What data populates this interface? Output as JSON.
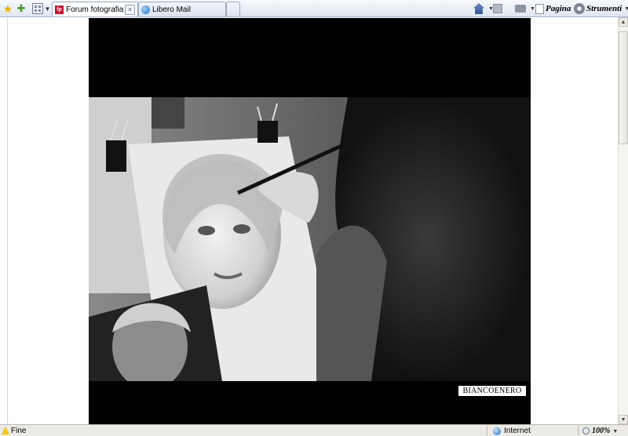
{
  "toolbar": {
    "tabs": [
      {
        "label": "Forum fotografia : photo...",
        "close": "×"
      },
      {
        "label": "Libero Mail"
      }
    ],
    "commands": {
      "page_label": "Pagina",
      "tools_label": "Strumenti"
    },
    "icons": [
      "favorites-star-icon",
      "add-favorite-icon",
      "quick-tabs-icon",
      "home-icon",
      "feeds-icon",
      "print-icon",
      "page-icon",
      "tools-gear-icon"
    ]
  },
  "content": {
    "watermark": "BIANCOENERO"
  },
  "statusbar": {
    "status_text": "Fine",
    "zone": "Internet",
    "zoom": "100%"
  },
  "colors": {
    "toolbar_bg": "#dfe6f0",
    "frame_bg": "#000000",
    "statusbar_bg": "#eceae4"
  }
}
